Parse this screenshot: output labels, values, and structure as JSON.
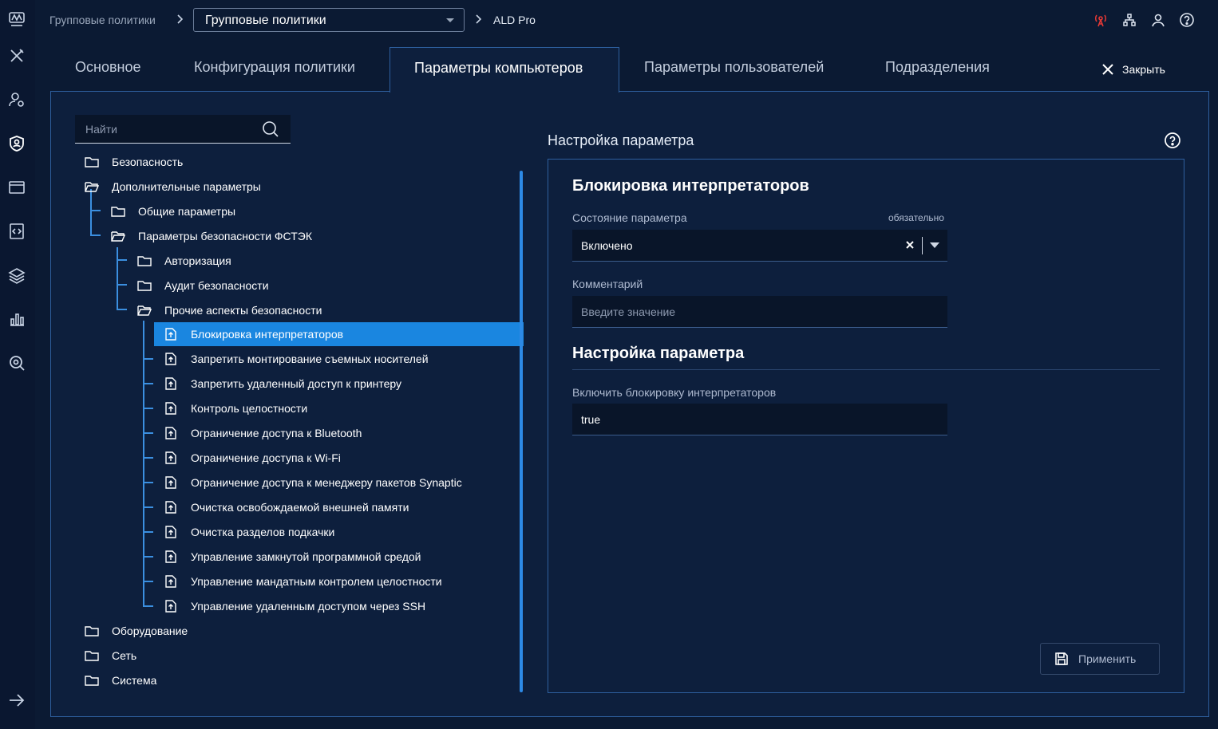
{
  "breadcrumb": {
    "root": "Групповые политики",
    "selected": "Групповые политики",
    "current": "ALD Pro"
  },
  "tabs": [
    {
      "label": "Основное"
    },
    {
      "label": "Конфигурация политики"
    },
    {
      "label": "Параметры компьютеров",
      "active": true
    },
    {
      "label": "Параметры пользователей"
    },
    {
      "label": "Подразделения"
    }
  ],
  "close_label": "Закрыть",
  "search": {
    "placeholder": "Найти"
  },
  "tree": {
    "rows": [
      {
        "label": "Безопасность",
        "icon": "folder-icon"
      },
      {
        "label": "Дополнительные параметры",
        "icon": "folder-open-icon"
      },
      {
        "label": "Общие параметры",
        "icon": "folder-icon"
      },
      {
        "label": "Параметры безопасности ФСТЭК",
        "icon": "folder-open-icon"
      },
      {
        "label": "Авторизация",
        "icon": "folder-icon"
      },
      {
        "label": "Аудит безопасности",
        "icon": "folder-icon"
      },
      {
        "label": "Прочие аспекты безопасности",
        "icon": "folder-open-icon"
      },
      {
        "label": "Блокировка интерпретаторов",
        "icon": "policy-file-icon",
        "selected": true
      },
      {
        "label": "Запретить монтирование съемных носителей",
        "icon": "policy-file-icon"
      },
      {
        "label": "Запретить удаленный доступ к принтеру",
        "icon": "policy-file-icon"
      },
      {
        "label": "Контроль целостности",
        "icon": "policy-file-icon"
      },
      {
        "label": "Ограничение доступа к Bluetooth",
        "icon": "policy-file-icon"
      },
      {
        "label": "Ограничение доступа к Wi-Fi",
        "icon": "policy-file-icon"
      },
      {
        "label": "Ограничение доступа к менеджеру пакетов Synaptic",
        "icon": "policy-file-icon"
      },
      {
        "label": "Очистка освобождаемой внешней памяти",
        "icon": "policy-file-icon"
      },
      {
        "label": "Очистка разделов подкачки",
        "icon": "policy-file-icon"
      },
      {
        "label": "Управление замкнутой программной средой",
        "icon": "policy-file-icon"
      },
      {
        "label": "Управление мандатным контролем целостности",
        "icon": "policy-file-icon"
      },
      {
        "label": "Управление удаленным доступом через SSH",
        "icon": "policy-file-icon"
      },
      {
        "label": "Оборудование",
        "icon": "folder-icon"
      },
      {
        "label": "Сеть",
        "icon": "folder-icon"
      },
      {
        "label": "Система",
        "icon": "folder-icon"
      }
    ]
  },
  "detail": {
    "section_title": "Настройка параметра",
    "heading": "Блокировка интерпретаторов",
    "state_label": "Состояние параметра",
    "required_label": "обязательно",
    "state_value": "Включено",
    "comment_label": "Комментарий",
    "comment_placeholder": "Введите значение",
    "settings_heading": "Настройка параметра",
    "setting_label": "Включить блокировку интерпретаторов",
    "setting_value": "true",
    "apply_label": "Применить"
  },
  "colors": {
    "background": "#0b1a33",
    "panel": "#0d1f3d",
    "accent": "#1a86e0",
    "alert_icon": "#e53935"
  }
}
